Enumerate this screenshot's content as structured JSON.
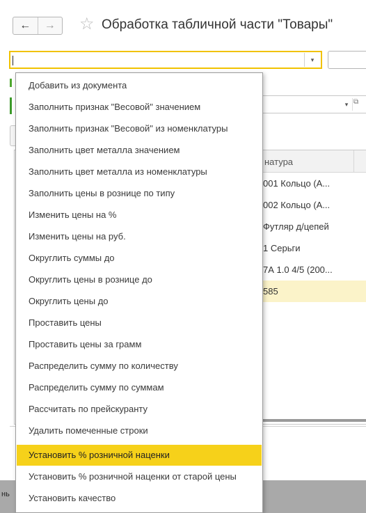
{
  "window": {
    "title": "Обработка табличной части \"Товары\"",
    "nav_back": "←",
    "nav_forward": "→",
    "favorite_icon": "star-outline-icon"
  },
  "combo": {
    "value": "",
    "dropdown_glyph": "▾"
  },
  "background_field": {
    "dropdown_glyph": "▾",
    "open_icon": "⧉"
  },
  "table": {
    "header": "натура",
    "rows": [
      "001 Кольцо (А...",
      "002 Кольцо (А...",
      "Футляр д/цепей",
      "1 Серьги",
      "7А 1.0 4/5 (200...",
      "585"
    ],
    "selected_row": 5
  },
  "footer": {
    "fragment": "нь"
  },
  "menu": {
    "highlighted_index": 18,
    "items": [
      "Добавить из документа",
      "Заполнить признак \"Весовой\" значением",
      "Заполнить признак \"Весовой\" из номенклатуры",
      "Заполнить цвет металла значением",
      "Заполнить цвет металла из номенклатуры",
      "Заполнить цены в рознице по типу",
      "Изменить цены на %",
      "Изменить цены на руб.",
      "Округлить суммы до",
      "Округлить цены в рознице до",
      "Округлить цены до",
      "Проставить цены",
      "Проставить цены за грамм",
      "Распределить сумму по количеству",
      "Распределить сумму по суммам",
      "Рассчитать по прейскуранту",
      "Удалить помеченные строки",
      "Установить % розничной наценки",
      "Установить % розничной наценки от старой цены",
      "Установить качество"
    ]
  },
  "colors": {
    "highlight": "#f6d11a",
    "focus_border": "#f1c200",
    "selected_row": "#fbf3c9",
    "accent_green": "#3c9a2a"
  }
}
